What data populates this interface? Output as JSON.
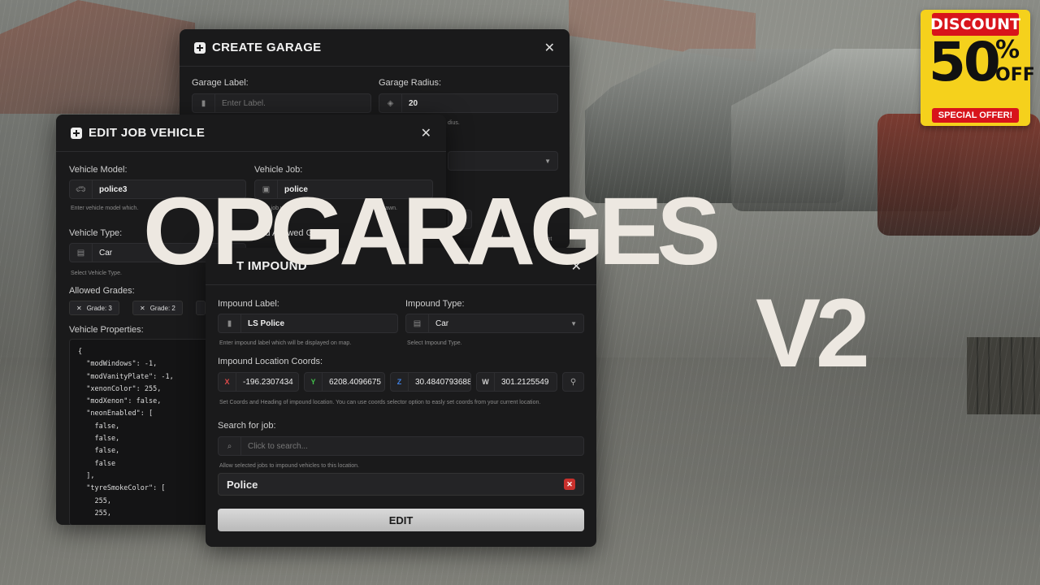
{
  "create_garage": {
    "title": "CREATE GARAGE",
    "garage_label_label": "Garage Label:",
    "garage_label_placeholder": "Enter Label.",
    "garage_radius_label": "Garage Radius:",
    "garage_radius_value": "20",
    "radius_hint_partial": "dius.",
    "hint2_partial": "set",
    "hint3_partial": "from yo",
    "hint4_partial": "urrent",
    "w_partial": "W"
  },
  "edit_job_vehicle": {
    "title": "EDIT JOB VEHICLE",
    "vehicle_model_label": "Vehicle Model:",
    "vehicle_model_value": "police3",
    "vehicle_model_hint": "Enter vehicle model which.",
    "vehicle_job_label": "Vehicle Job:",
    "vehicle_job_value": "police",
    "vehicle_job_hint": "Enter job which.",
    "vehicle_job_hint_tail": "to spawn.",
    "vehicle_type_label": "Vehicle Type:",
    "vehicle_type_value": "Car",
    "vehicle_type_hint": "Select Vehicle Type.",
    "allowed_grades_label": "Allowed Grades:",
    "add_allowed_label": "Add Allowed G",
    "grades": [
      "Grade: 3",
      "Grade: 2"
    ],
    "vehicle_properties_label": "Vehicle Properties:",
    "vehicle_properties_json": "{\n  \"modWindows\": -1,\n  \"modVanityPlate\": -1,\n  \"xenonColor\": 255,\n  \"modXenon\": false,\n  \"neonEnabled\": [\n    false,\n    false,\n    false,\n    false\n  ],\n  \"tyreSmokeColor\": [\n    255,\n    255,"
  },
  "edit_impound": {
    "title": "T IMPOUND",
    "impound_label_label": "Impound Label:",
    "impound_label_value": "LS Police",
    "impound_label_hint": "Enter impound label which will be displayed on map.",
    "impound_type_label": "Impound Type:",
    "impound_type_value": "Car",
    "impound_type_hint": "Select Impound Type.",
    "coords_label": "Impound Location Coords:",
    "coords": {
      "x": "-196.2307434",
      "y": "6208.4096675",
      "z": "30.4840793688",
      "w": "301.2125549"
    },
    "coord_tags": {
      "x": "X",
      "y": "Y",
      "z": "Z",
      "w": "W"
    },
    "coords_hint": "Set Coords and Heading of impound location. You can use coords selector option to easly set coords from your current location.",
    "search_label": "Search for job:",
    "search_placeholder": "Click to search...",
    "search_hint": "Allow selected jobs to impound vehicles to this location.",
    "selected_job": "Police",
    "edit_button": "EDIT"
  },
  "overlay_title": {
    "line1": "OPGARAGES",
    "line2": "V2"
  },
  "badge": {
    "top": "DISCOUNT",
    "number": "50",
    "percent": "%",
    "off": "OFF",
    "bottom": "SPECIAL OFFER!"
  },
  "colors": {
    "panel": "#1a1a1b",
    "title_text": "#ede8e1",
    "badge_yellow": "#f5d11c",
    "badge_red": "#d8141b",
    "delete_red": "#c9302c"
  }
}
